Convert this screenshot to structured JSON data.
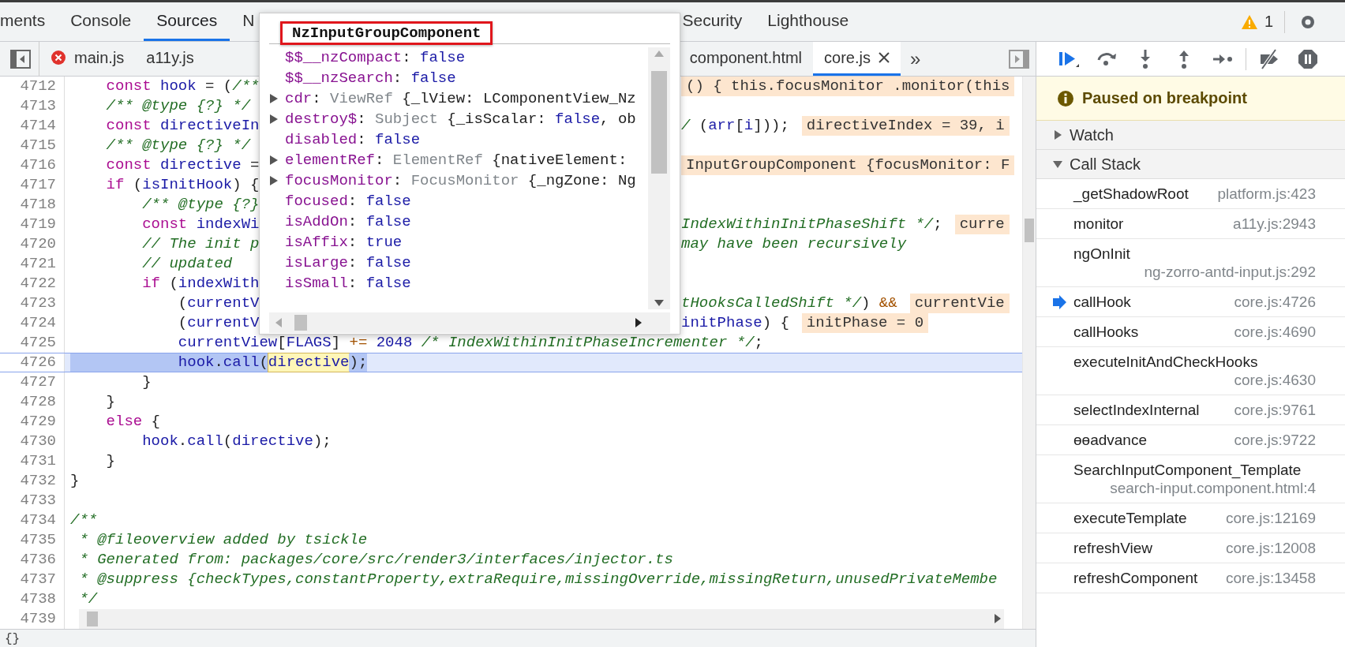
{
  "top_tabs": [
    {
      "label": "ments",
      "selected": false
    },
    {
      "label": "Console",
      "selected": false
    },
    {
      "label": "Sources",
      "selected": true
    },
    {
      "label": "N",
      "selected": false
    },
    {
      "label": "Security",
      "selected": false
    },
    {
      "label": "Lighthouse",
      "selected": false
    }
  ],
  "warnings": {
    "count": "1"
  },
  "file_tabs": [
    {
      "label": "main.js",
      "error": true,
      "selected": false,
      "closable": false
    },
    {
      "label": "a11y.js",
      "error": false,
      "selected": false,
      "closable": false
    },
    {
      "label": "component.html",
      "error": false,
      "selected": false,
      "closable": false
    },
    {
      "label": "core.js",
      "error": false,
      "selected": true,
      "closable": true
    }
  ],
  "more_tabs": "»",
  "code": {
    "lines": [
      {
        "number": "4712",
        "current": false,
        "code": [
          {
            "text": "    const",
            "kind": "kw"
          },
          {
            "text": " hook",
            "kind": "id"
          },
          {
            "text": " = (",
            "kind": "pl"
          },
          {
            "text": "/**",
            "kind": "cm"
          }
        ],
        "right": [
          {
            "text": "() { this.focusMonitor .monitor(this",
            "kind": "ann"
          }
        ]
      },
      {
        "number": "4713",
        "current": false,
        "code": [
          {
            "text": "    /** @type {?} */",
            "kind": "cm"
          }
        ]
      },
      {
        "number": "4714",
        "current": false,
        "code": [
          {
            "text": "    const",
            "kind": "kw"
          },
          {
            "text": " directiveIn",
            "kind": "id"
          }
        ],
        "right": [
          {
            "text": "/",
            "kind": "cm"
          },
          {
            "text": " (",
            "kind": "pl"
          },
          {
            "text": "arr",
            "kind": "id"
          },
          {
            "text": "[",
            "kind": "pl"
          },
          {
            "text": "i",
            "kind": "id"
          },
          {
            "text": "]));",
            "kind": "pl"
          },
          {
            "text": "directiveIndex = 39, i",
            "kind": "ann"
          }
        ]
      },
      {
        "number": "4715",
        "current": false,
        "code": [
          {
            "text": "    /** @type {?} */",
            "kind": "cm"
          }
        ]
      },
      {
        "number": "4716",
        "current": false,
        "code": [
          {
            "text": "    const",
            "kind": "kw"
          },
          {
            "text": " directive",
            "kind": "id"
          },
          {
            "text": " =",
            "kind": "pl"
          }
        ],
        "right": [
          {
            "text": "InputGroupComponent {focusMonitor: F",
            "kind": "ann"
          }
        ]
      },
      {
        "number": "4717",
        "current": false,
        "code": [
          {
            "text": "    if",
            "kind": "kw"
          },
          {
            "text": " (",
            "kind": "pl"
          },
          {
            "text": "isInitHook",
            "kind": "id"
          },
          {
            "text": ") {",
            "kind": "pl"
          }
        ]
      },
      {
        "number": "4718",
        "current": false,
        "code": [
          {
            "text": "        /** @type {?}",
            "kind": "cm"
          }
        ]
      },
      {
        "number": "4719",
        "current": false,
        "code": [
          {
            "text": "        const",
            "kind": "kw"
          },
          {
            "text": " indexWi",
            "kind": "id"
          }
        ],
        "right": [
          {
            "text": "IndexWithinInitPhaseShift */",
            "kind": "cm"
          },
          {
            "text": ";",
            "kind": "pl"
          },
          {
            "text": "curre",
            "kind": "ann"
          }
        ]
      },
      {
        "number": "4720",
        "current": false,
        "code": [
          {
            "text": "        // The init p",
            "kind": "cm"
          }
        ],
        "right": [
          {
            "text": "may have been recursively",
            "kind": "cm"
          }
        ]
      },
      {
        "number": "4721",
        "current": false,
        "code": [
          {
            "text": "        // updated",
            "kind": "cm"
          }
        ]
      },
      {
        "number": "4722",
        "current": false,
        "code": [
          {
            "text": "        if",
            "kind": "kw"
          },
          {
            "text": " (",
            "kind": "pl"
          },
          {
            "text": "indexWith",
            "kind": "id"
          }
        ]
      },
      {
        "number": "4723",
        "current": false,
        "code": [
          {
            "text": "            (",
            "kind": "pl"
          },
          {
            "text": "currentV",
            "kind": "id"
          }
        ],
        "right": [
          {
            "text": "tHooksCalledShift */",
            "kind": "cm"
          },
          {
            "text": ") ",
            "kind": "pl"
          },
          {
            "text": "&&",
            "kind": "op"
          },
          {
            "text": "currentVie",
            "kind": "ann"
          }
        ]
      },
      {
        "number": "4724",
        "current": false,
        "code": [
          {
            "text": "            (",
            "kind": "pl"
          },
          {
            "text": "currentV",
            "kind": "id"
          }
        ],
        "right": [
          {
            "text": "initPhase",
            "kind": "id"
          },
          {
            "text": ") {",
            "kind": "pl"
          },
          {
            "text": "initPhase = 0",
            "kind": "ann"
          }
        ]
      },
      {
        "number": "4725",
        "current": false,
        "code": [
          {
            "text": "            currentView",
            "kind": "id"
          },
          {
            "text": "[",
            "kind": "pl"
          },
          {
            "text": "FLAGS",
            "kind": "id"
          },
          {
            "text": "] ",
            "kind": "pl"
          },
          {
            "text": "+=",
            "kind": "op"
          },
          {
            "text": " 2048",
            "kind": "num"
          },
          {
            "text": " /* IndexWithinInitPhaseIncrementer */",
            "kind": "cm"
          },
          {
            "text": ";",
            "kind": "pl"
          }
        ]
      },
      {
        "number": "4726",
        "current": true,
        "code": [
          {
            "text": "            hook",
            "kind": "id"
          },
          {
            "text": ".",
            "kind": "pl"
          },
          {
            "text": "call",
            "kind": "id"
          },
          {
            "text": "(",
            "kind": "pl"
          },
          {
            "text": "directive",
            "kind": "hover"
          },
          {
            "text": ");",
            "kind": "pl"
          }
        ]
      },
      {
        "number": "4727",
        "current": false,
        "code": [
          {
            "text": "        }",
            "kind": "pl"
          }
        ]
      },
      {
        "number": "4728",
        "current": false,
        "code": [
          {
            "text": "    }",
            "kind": "pl"
          }
        ]
      },
      {
        "number": "4729",
        "current": false,
        "code": [
          {
            "text": "    else",
            "kind": "kw"
          },
          {
            "text": " {",
            "kind": "pl"
          }
        ]
      },
      {
        "number": "4730",
        "current": false,
        "code": [
          {
            "text": "        hook",
            "kind": "id"
          },
          {
            "text": ".",
            "kind": "pl"
          },
          {
            "text": "call",
            "kind": "id"
          },
          {
            "text": "(",
            "kind": "pl"
          },
          {
            "text": "directive",
            "kind": "id"
          },
          {
            "text": ");",
            "kind": "pl"
          }
        ]
      },
      {
        "number": "4731",
        "current": false,
        "code": [
          {
            "text": "    }",
            "kind": "pl"
          }
        ]
      },
      {
        "number": "4732",
        "current": false,
        "code": [
          {
            "text": "}",
            "kind": "pl"
          }
        ]
      },
      {
        "number": "4733",
        "current": false
      },
      {
        "number": "4734",
        "current": false,
        "code": [
          {
            "text": "/**",
            "kind": "cm"
          }
        ]
      },
      {
        "number": "4735",
        "current": false,
        "code": [
          {
            "text": " * @fileoverview added by tsickle",
            "kind": "cm"
          }
        ]
      },
      {
        "number": "4736",
        "current": false,
        "code": [
          {
            "text": " * Generated from: packages/core/src/render3/interfaces/injector.ts",
            "kind": "cm"
          }
        ]
      },
      {
        "number": "4737",
        "current": false,
        "code": [
          {
            "text": " * @suppress {checkTypes,constantProperty,extraRequire,missingOverride,missingReturn,unusedPrivateMembe",
            "kind": "cm"
          }
        ]
      },
      {
        "number": "4738",
        "current": false,
        "code": [
          {
            "text": " */",
            "kind": "cm"
          }
        ]
      },
      {
        "number": "4739",
        "current": false
      }
    ]
  },
  "popup": {
    "title": "NzInputGroupComponent",
    "properties": [
      {
        "name": "$$__nzCompact",
        "expandable": false,
        "value": [
          {
            "text": ": ",
            "kind": "pl"
          },
          {
            "text": "false",
            "kind": "bool"
          }
        ]
      },
      {
        "name": "$$__nzSearch",
        "expandable": false,
        "value": [
          {
            "text": ": ",
            "kind": "pl"
          },
          {
            "text": "false",
            "kind": "bool"
          }
        ]
      },
      {
        "name": "cdr",
        "expandable": true,
        "value": [
          {
            "text": ": ",
            "kind": "pl"
          },
          {
            "text": "ViewRef",
            "kind": "cls"
          },
          {
            "text": " {_lView: LComponentView_Nz",
            "kind": "pl"
          }
        ]
      },
      {
        "name": "destroy$",
        "expandable": true,
        "value": [
          {
            "text": ": ",
            "kind": "pl"
          },
          {
            "text": "Subject",
            "kind": "cls"
          },
          {
            "text": " {_isScalar: ",
            "kind": "pl"
          },
          {
            "text": "false",
            "kind": "bool"
          },
          {
            "text": ", ob",
            "kind": "pl"
          }
        ]
      },
      {
        "name": "disabled",
        "expandable": false,
        "value": [
          {
            "text": ": ",
            "kind": "pl"
          },
          {
            "text": "false",
            "kind": "bool"
          }
        ]
      },
      {
        "name": "elementRef",
        "expandable": true,
        "value": [
          {
            "text": ": ",
            "kind": "pl"
          },
          {
            "text": "ElementRef",
            "kind": "cls"
          },
          {
            "text": " {nativeElement:",
            "kind": "pl"
          }
        ]
      },
      {
        "name": "focusMonitor",
        "expandable": true,
        "value": [
          {
            "text": ": ",
            "kind": "pl"
          },
          {
            "text": "FocusMonitor",
            "kind": "cls"
          },
          {
            "text": " {_ngZone: Ng",
            "kind": "pl"
          }
        ]
      },
      {
        "name": "focused",
        "expandable": false,
        "value": [
          {
            "text": ": ",
            "kind": "pl"
          },
          {
            "text": "false",
            "kind": "bool"
          }
        ]
      },
      {
        "name": "isAddOn",
        "expandable": false,
        "value": [
          {
            "text": ": ",
            "kind": "pl"
          },
          {
            "text": "false",
            "kind": "bool"
          }
        ]
      },
      {
        "name": "isAffix",
        "expandable": false,
        "value": [
          {
            "text": ": ",
            "kind": "pl"
          },
          {
            "text": "true",
            "kind": "bool"
          }
        ]
      },
      {
        "name": "isLarge",
        "expandable": false,
        "value": [
          {
            "text": ": ",
            "kind": "pl"
          },
          {
            "text": "false",
            "kind": "bool"
          }
        ]
      },
      {
        "name": "isSmall",
        "expandable": false,
        "value": [
          {
            "text": ": ",
            "kind": "pl"
          },
          {
            "text": "false",
            "kind": "bool"
          }
        ]
      }
    ]
  },
  "debugger": {
    "paused_message": "Paused on breakpoint",
    "sections": [
      {
        "label": "Watch",
        "expanded": false
      },
      {
        "label": "Call Stack",
        "expanded": true
      }
    ],
    "frames": [
      {
        "name": "_getShadowRoot",
        "location": "platform.js:423",
        "current": false
      },
      {
        "name": "monitor",
        "location": "a11y.js:2943",
        "current": false
      },
      {
        "name": "ngOnInit",
        "location": "ng-zorro-antd-input.js:292",
        "current": false
      },
      {
        "name": "callHook",
        "location": "core.js:4726",
        "current": true
      },
      {
        "name": "callHooks",
        "location": "core.js:4690",
        "current": false
      },
      {
        "name": "executeInitAndCheckHooks",
        "location": "core.js:4630",
        "current": false
      },
      {
        "name": "selectIndexInternal",
        "location": "core.js:9761",
        "current": false
      },
      {
        "name": "ɵɵadvance",
        "location": "core.js:9722",
        "current": false
      },
      {
        "name": "SearchInputComponent_Template",
        "location": "search-input.component.html:4",
        "current": false
      },
      {
        "name": "executeTemplate",
        "location": "core.js:12169",
        "current": false
      },
      {
        "name": "refreshView",
        "location": "core.js:12008",
        "current": false
      },
      {
        "name": "refreshComponent",
        "location": "core.js:13458",
        "current": false
      }
    ]
  },
  "pretty_print": "{}"
}
